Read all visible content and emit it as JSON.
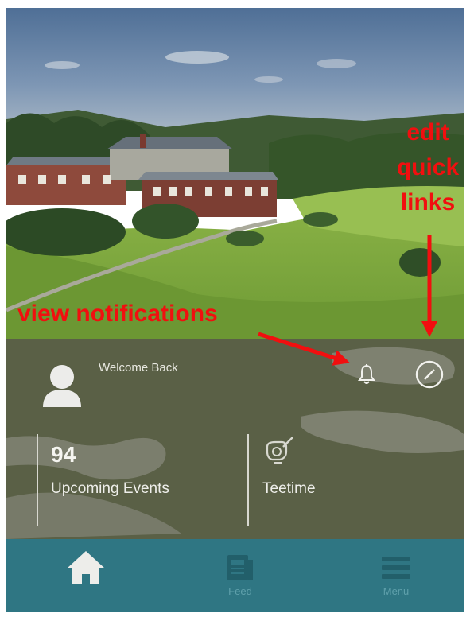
{
  "header": {
    "image": "golf-course-clubhouse-photo"
  },
  "welcome": {
    "greeting": "Welcome Back",
    "avatar_icon": "user-avatar-icon",
    "notification_icon": "bell-icon",
    "edit_icon": "compass-edit-icon"
  },
  "stats": [
    {
      "count": "94",
      "label": "Upcoming Events"
    },
    {
      "icon": "golf-teetime-icon",
      "label": "Teetime"
    }
  ],
  "nav": {
    "items": [
      {
        "icon": "home-icon",
        "label": ""
      },
      {
        "icon": "feed-icon",
        "label": "Feed"
      },
      {
        "icon": "menu-icon",
        "label": "Menu"
      }
    ]
  },
  "annotations": {
    "edit_quick_links": "edit\nquick\nlinks",
    "edit_line1": "edit",
    "edit_line2": "quick",
    "edit_line3": "links",
    "view_notifications": "view notifications"
  },
  "colors": {
    "panel": "#5a6046",
    "nav": "#2f7683",
    "nav_label": "#5fa0ab",
    "annotation": "#f10f0f"
  }
}
